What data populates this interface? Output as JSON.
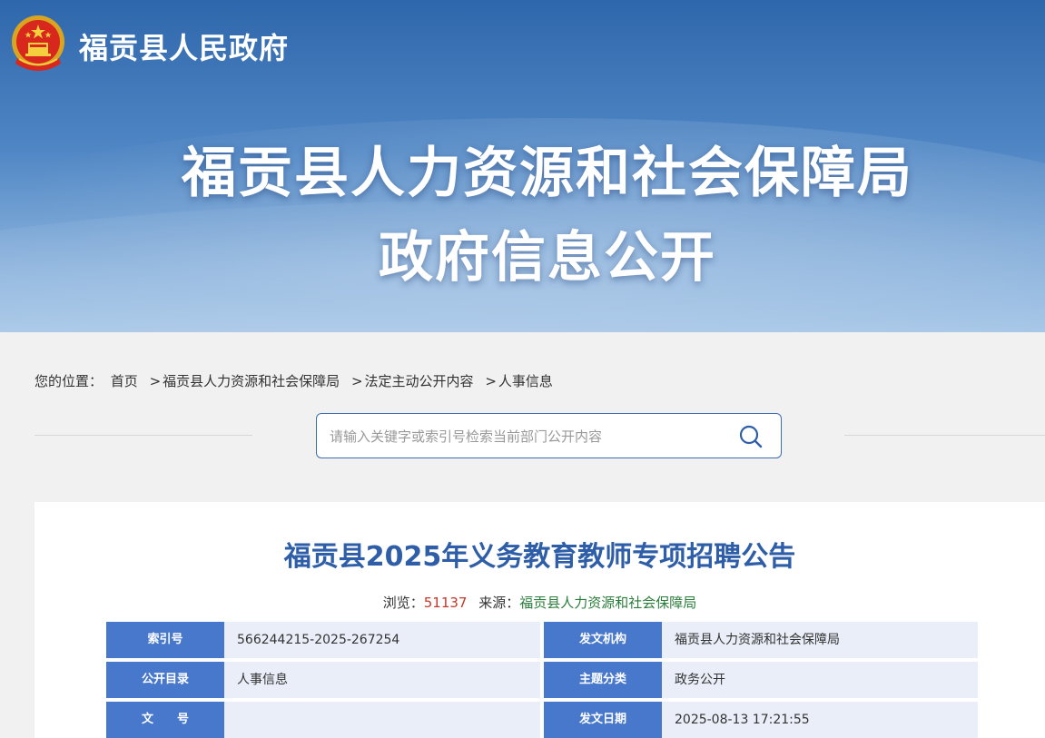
{
  "header": {
    "gov_name": "福贡县人民政府",
    "hero_line1": "福贡县人力资源和社会保障局",
    "hero_line2": "政府信息公开"
  },
  "breadcrumb": {
    "prefix": "您的位置：",
    "items": [
      "首页",
      "福贡县人力资源和社会保障局",
      "法定主动公开内容",
      "人事信息"
    ],
    "separator": ">"
  },
  "search": {
    "placeholder": "请输入关键字或索引号检索当前部门公开内容",
    "value": ""
  },
  "article": {
    "title": "福贡县2025年义务教育教师专项招聘公告",
    "views_label": "浏览：",
    "views": "51137",
    "source_label": "来源：",
    "source": "福贡县人力资源和社会保障局"
  },
  "info_table": {
    "rows": [
      {
        "left_label": "索引号",
        "left_value": "566244215-2025-267254",
        "right_label": "发文机构",
        "right_value": "福贡县人力资源和社会保障局"
      },
      {
        "left_label": "公开目录",
        "left_value": "人事信息",
        "right_label": "主题分类",
        "right_value": "政务公开"
      },
      {
        "left_label": "文　　号",
        "left_value": "",
        "right_label": "发文日期",
        "right_value": "2025-08-13 17:21:55"
      }
    ]
  },
  "colors": {
    "brand_blue": "#2e5ea8",
    "label_blue": "#4878cc",
    "views_red": "#c0392b",
    "source_green": "#2a7d3a"
  }
}
